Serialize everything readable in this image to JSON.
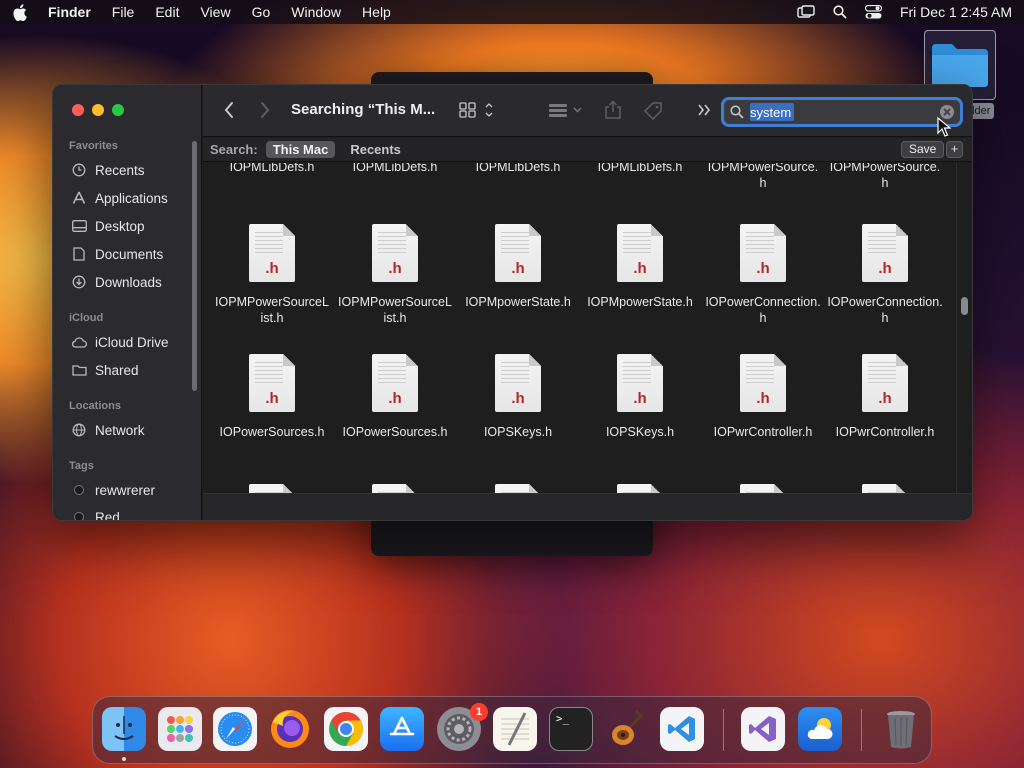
{
  "menubar": {
    "app_name": "Finder",
    "menus": [
      "File",
      "Edit",
      "View",
      "Go",
      "Window",
      "Help"
    ],
    "datetime": "Fri Dec 1  2:45 AM"
  },
  "desktop": {
    "folder_label": "older"
  },
  "finder": {
    "title": "Searching “This M...",
    "search": {
      "value": "system"
    },
    "scope": {
      "label": "Search:",
      "options": [
        "This Mac",
        "Recents"
      ],
      "selected": "This Mac",
      "save_label": "Save",
      "add_label": "+"
    },
    "sidebar": {
      "favorites_header": "Favorites",
      "favorites": [
        "Recents",
        "Applications",
        "Desktop",
        "Documents",
        "Downloads"
      ],
      "icloud_header": "iCloud",
      "icloud": [
        "iCloud Drive",
        "Shared"
      ],
      "locations_header": "Locations",
      "locations": [
        "Network"
      ],
      "tags_header": "Tags",
      "tags": [
        "rewwrerer",
        "Red"
      ]
    },
    "files": {
      "row0": [
        "IOPMLibDefs.h",
        "IOPMLibDefs.h",
        "IOPMLibDefs.h",
        "IOPMLibDefs.h",
        "IOPMPowerSource.h",
        "IOPMPowerSource.h"
      ],
      "row1": [
        "IOPMPowerSourceList.h",
        "IOPMPowerSourceList.h",
        "IOPMpowerState.h",
        "IOPMpowerState.h",
        "IOPowerConnection.h",
        "IOPowerConnection.h"
      ],
      "row2": [
        "IOPowerSources.h",
        "IOPowerSources.h",
        "IOPSKeys.h",
        "IOPSKeys.h",
        "IOPwrController.h",
        "IOPwrController.h"
      ],
      "ext": ".h"
    }
  },
  "dock": {
    "apps": [
      "Finder",
      "Launchpad",
      "Safari",
      "Firefox",
      "Chrome",
      "App Store",
      "System Settings",
      "TextEdit",
      "Terminal",
      "GarageBand",
      "Visual Studio Code",
      "Visual Studio",
      "Weather",
      "Trash"
    ],
    "settings_badge": "1",
    "terminal_prompt": ">_"
  }
}
